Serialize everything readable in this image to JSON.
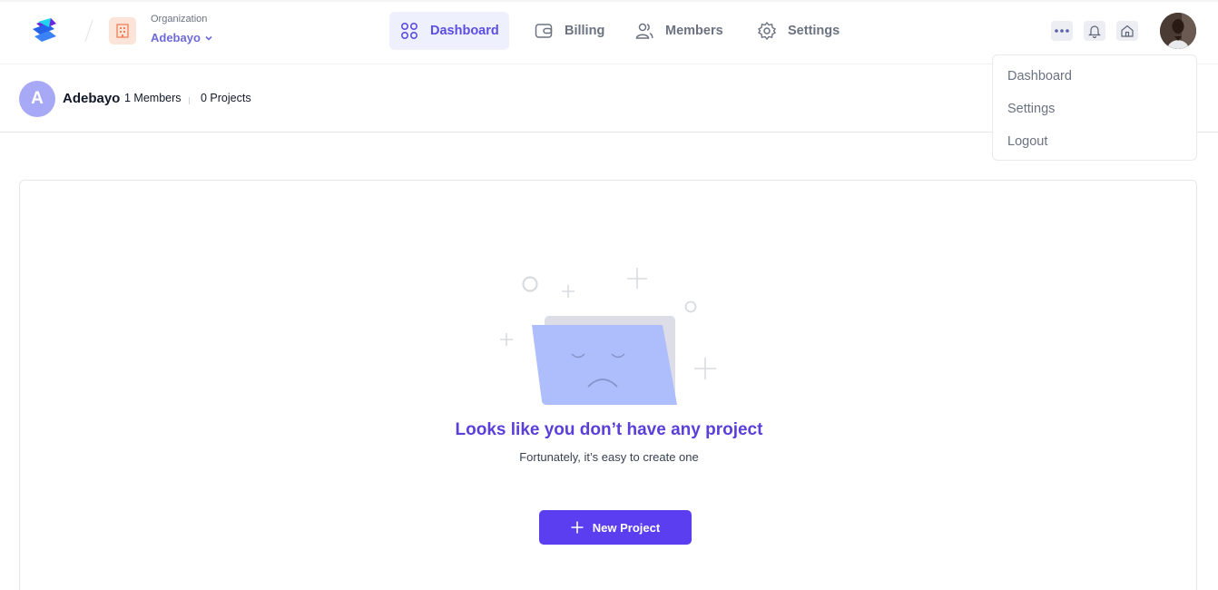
{
  "header": {
    "org_label": "Organization",
    "org_name": "Adebayo",
    "nav": [
      {
        "label": "Dashboard",
        "icon": "grid-icon",
        "active": true
      },
      {
        "label": "Billing",
        "icon": "wallet-icon",
        "active": false
      },
      {
        "label": "Members",
        "icon": "users-icon",
        "active": false
      },
      {
        "label": "Settings",
        "icon": "gear-icon",
        "active": false
      }
    ]
  },
  "user_menu": {
    "items": [
      "Dashboard",
      "Settings",
      "Logout"
    ]
  },
  "org_header": {
    "avatar_initial": "A",
    "name": "Adebayo",
    "members": "1 Members",
    "projects": "0 Projects"
  },
  "empty_state": {
    "title": "Looks like you don’t have any project",
    "subtitle": "Fortunately, it’s easy to create one",
    "button_label": "New Project"
  },
  "colors": {
    "accent": "#5b3ef0",
    "nav_active_bg": "#eef0fd",
    "title": "#5b3fd9"
  }
}
